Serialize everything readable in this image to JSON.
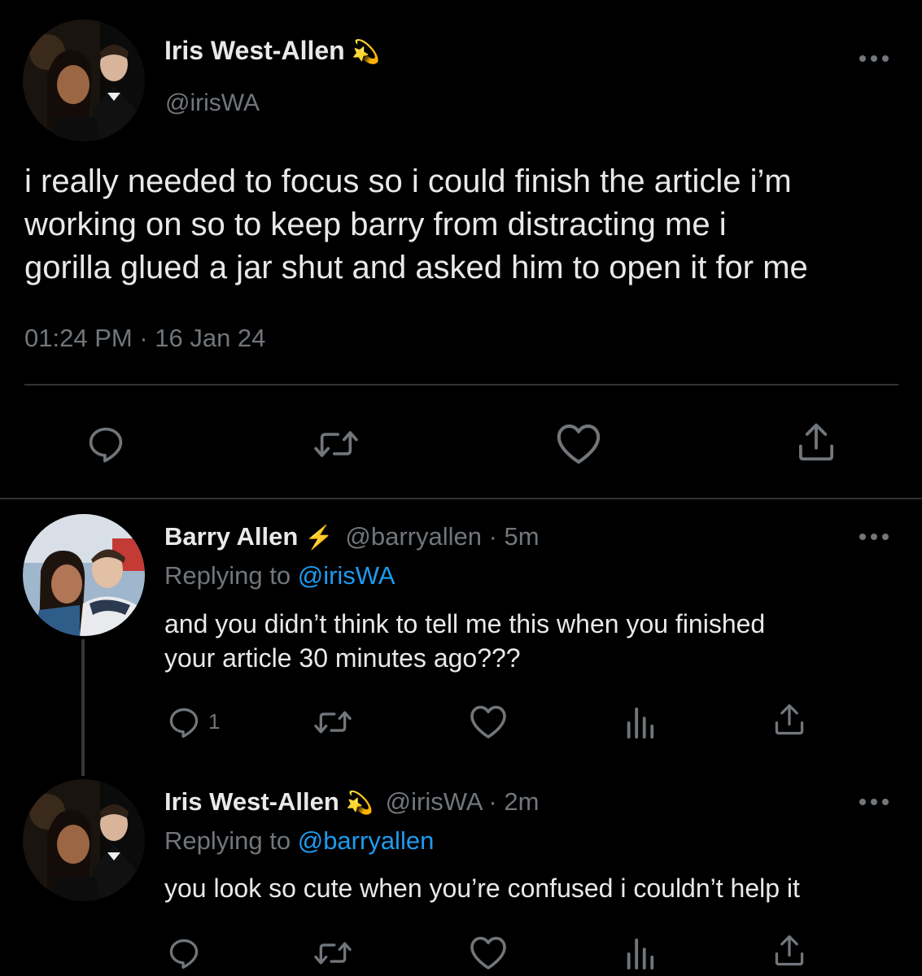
{
  "main_tweet": {
    "name": "Iris West-Allen",
    "name_emoji": "💫",
    "handle": "@irisWA",
    "text_lines": [
      "i really needed to focus so i could finish the article i’m",
      "working on so to keep barry from distracting me i",
      "gorilla glued a jar shut and asked him to open it for me"
    ],
    "timestamp": "01:24 PM · 16 Jan 24",
    "actions": [
      "reply-icon",
      "retweet-icon",
      "like-icon",
      "share-icon"
    ]
  },
  "replies": [
    {
      "name": "Barry Allen",
      "name_emoji": "⚡",
      "handle_time": "@barryallen · 5m",
      "replying_prefix": "Replying to",
      "replying_to": "@irisWA",
      "text_lines": [
        "and you didn’t think to tell me this when you finished",
        "your article 30 minutes ago???"
      ],
      "reply_count": "1",
      "actions": [
        "reply-icon",
        "retweet-icon",
        "like-icon",
        "views-icon",
        "share-icon"
      ]
    },
    {
      "name": "Iris West-Allen",
      "name_emoji": "💫",
      "handle_time": "@irisWA · 2m",
      "replying_prefix": "Replying to",
      "replying_to": "@barryallen",
      "text_lines": [
        "you look so cute when you’re confused i couldn’t help it"
      ],
      "actions": [
        "reply-icon",
        "retweet-icon",
        "like-icon",
        "views-icon",
        "share-icon"
      ]
    }
  ],
  "colors": {
    "background": "#000000",
    "text": "#e7e9ea",
    "muted": "#71767b",
    "link": "#1d9bf0",
    "divider": "#2f3336"
  }
}
